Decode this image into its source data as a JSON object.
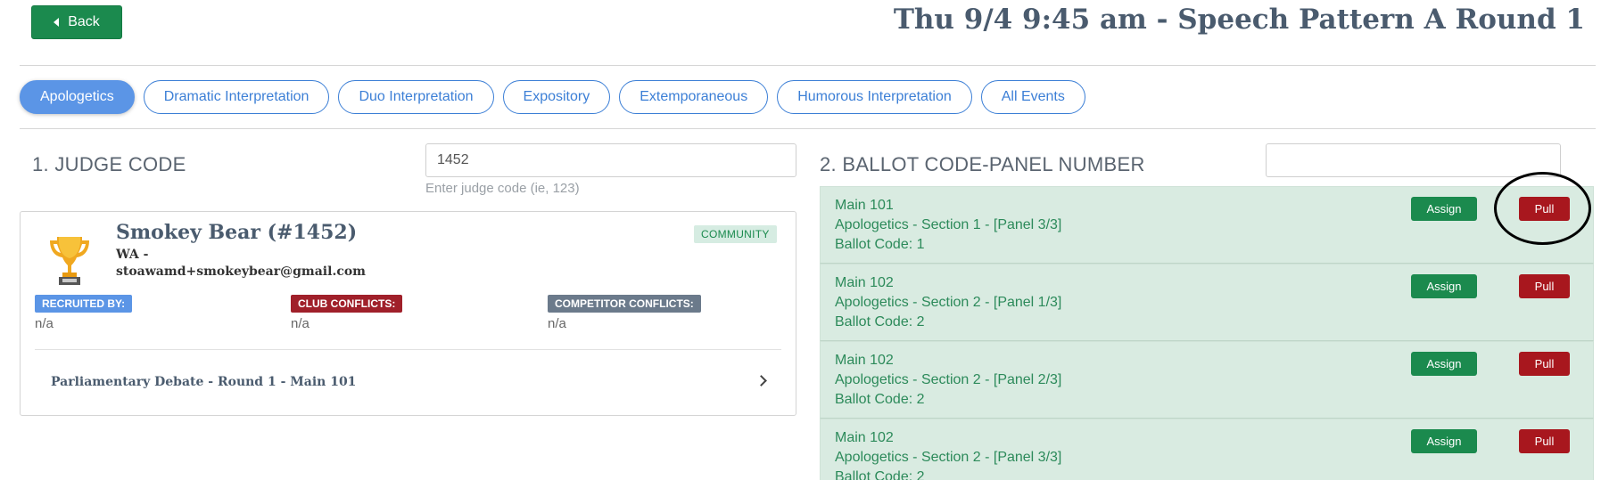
{
  "header": {
    "back_label": "Back",
    "title": "Thu 9/4 9:45 am - Speech Pattern A Round 1"
  },
  "tabs": [
    {
      "label": "Apologetics",
      "active": true
    },
    {
      "label": "Dramatic Interpretation",
      "active": false
    },
    {
      "label": "Duo Interpretation",
      "active": false
    },
    {
      "label": "Expository",
      "active": false
    },
    {
      "label": "Extemporaneous",
      "active": false
    },
    {
      "label": "Humorous Interpretation",
      "active": false
    },
    {
      "label": "All Events",
      "active": false
    }
  ],
  "judge": {
    "section_label": "1. JUDGE CODE",
    "input_value": "1452",
    "input_help": "Enter judge code (ie, 123)",
    "name": "Smokey Bear (#1452)",
    "state": "WA -",
    "email": "stoawamd+smokeybear@gmail.com",
    "badge": "COMMUNITY",
    "recruited_by_label": "RECRUITED BY:",
    "recruited_by_value": "n/a",
    "club_conflicts_label": "CLUB CONFLICTS:",
    "club_conflicts_value": "n/a",
    "competitor_conflicts_label": "COMPETITOR CONFLICTS:",
    "competitor_conflicts_value": "n/a",
    "assignment": "Parliamentary Debate - Round 1 - Main 101"
  },
  "ballot": {
    "section_label": "2. BALLOT CODE-PANEL NUMBER",
    "input_value": "",
    "assign_label": "Assign",
    "pull_label": "Pull",
    "rows": [
      {
        "room": "Main 101",
        "section": "Apologetics - Section 1 - [Panel 3/3]",
        "code": "Ballot Code: 1"
      },
      {
        "room": "Main 102",
        "section": "Apologetics - Section 2 - [Panel 1/3]",
        "code": "Ballot Code: 2"
      },
      {
        "room": "Main 102",
        "section": "Apologetics - Section 2 - [Panel 2/3]",
        "code": "Ballot Code: 2"
      },
      {
        "room": "Main 102",
        "section": "Apologetics - Section 2 - [Panel 3/3]",
        "code": "Ballot Code: 2"
      }
    ]
  },
  "colors": {
    "primary_green": "#1b8a4e",
    "pull_red": "#a8171e",
    "tab_blue": "#3c7fd6",
    "title_slate": "#4a5b6e"
  }
}
